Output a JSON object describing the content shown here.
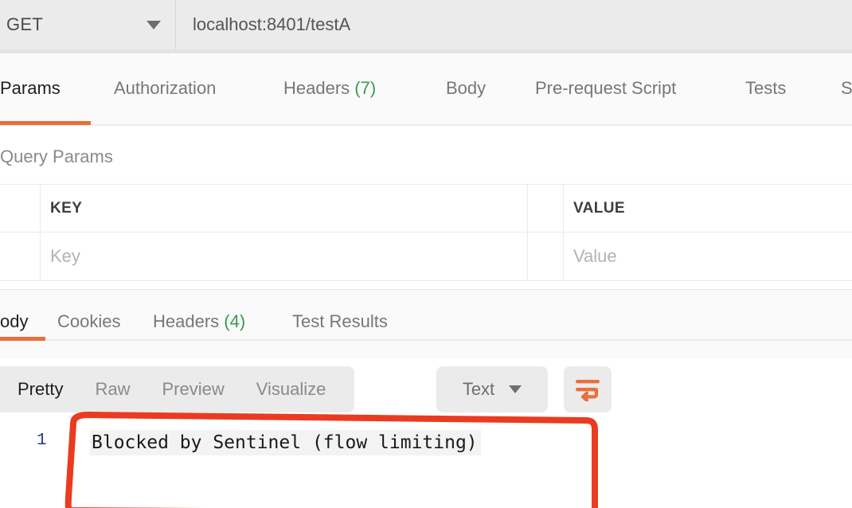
{
  "colors": {
    "accent_orange": "#e8703c",
    "annotation_red": "#ea3b21",
    "count_green": "#3a9a50",
    "line_number_blue": "#2a3a7c",
    "toolbar_gray": "#ebebeb"
  },
  "url_bar": {
    "method": "GET",
    "method_caret_icon": "chevron-down-icon",
    "url": "localhost:8401/testA"
  },
  "request_tabs": [
    {
      "label": "Params",
      "active": true,
      "count": null
    },
    {
      "label": "Authorization",
      "active": false,
      "count": null
    },
    {
      "label": "Headers",
      "active": false,
      "count": "(7)"
    },
    {
      "label": "Body",
      "active": false,
      "count": null
    },
    {
      "label": "Pre-request Script",
      "active": false,
      "count": null
    },
    {
      "label": "Tests",
      "active": false,
      "count": null
    },
    {
      "label": "S",
      "active": false,
      "count": null
    }
  ],
  "query_params": {
    "title": "Query Params",
    "columns": [
      "KEY",
      "VALUE"
    ],
    "rows": [
      {
        "key_placeholder": "Key",
        "value_placeholder": "Value"
      }
    ]
  },
  "response_tabs": [
    {
      "label": "ody",
      "active": true,
      "count": null
    },
    {
      "label": "Cookies",
      "active": false,
      "count": null
    },
    {
      "label": "Headers",
      "active": false,
      "count": "(4)"
    },
    {
      "label": "Test Results",
      "active": false,
      "count": null
    }
  ],
  "viewer": {
    "modes": [
      {
        "label": "Pretty",
        "active": true
      },
      {
        "label": "Raw",
        "active": false
      },
      {
        "label": "Preview",
        "active": false
      },
      {
        "label": "Visualize",
        "active": false
      }
    ],
    "format": "Text",
    "format_caret_icon": "chevron-down-icon",
    "wrap_icon": "word-wrap-icon"
  },
  "response_body": {
    "line_number": "1",
    "text": "Blocked by Sentinel (flow limiting)"
  },
  "annotation": {
    "shape": "hand-drawn-rectangle",
    "color": "#ea3b21"
  }
}
